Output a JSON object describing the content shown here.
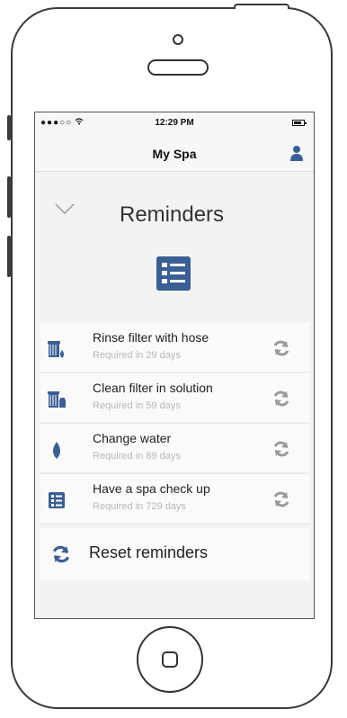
{
  "status": {
    "carrier": "●●●○○ ",
    "time": "12:29 PM"
  },
  "nav": {
    "title": "My Spa"
  },
  "header": {
    "title": "Reminders"
  },
  "reminders": [
    {
      "title": "Rinse filter with hose",
      "subtitle": "Required in 29 days",
      "icon": "filter-rinse-icon"
    },
    {
      "title": "Clean filter in solution",
      "subtitle": "Required in 59 days",
      "icon": "filter-clean-icon"
    },
    {
      "title": "Change water",
      "subtitle": "Required in 89 days",
      "icon": "water-drop-icon"
    },
    {
      "title": "Have a spa check up",
      "subtitle": "Required in 729 days",
      "icon": "checklist-icon"
    }
  ],
  "reset": {
    "label": "Reset reminders"
  },
  "colors": {
    "accent": "#3a5f94",
    "subtitle": "#b8b8b8",
    "refresh": "#9a9a9a"
  }
}
